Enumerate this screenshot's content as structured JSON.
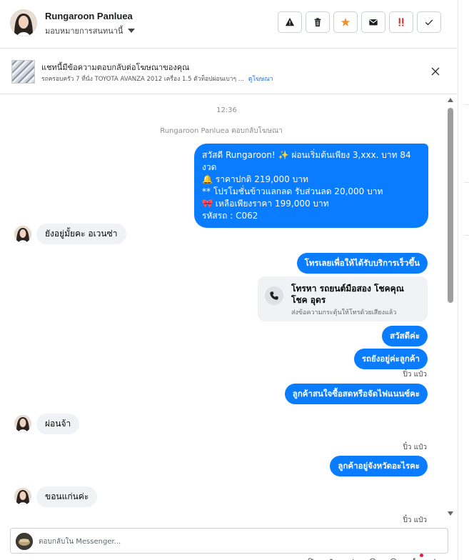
{
  "header": {
    "contact_name": "Rungaroon Panluea",
    "assign_label": "มอบหมายการสนทนานี้",
    "actions": [
      {
        "name": "report-button",
        "icon": "warning-icon"
      },
      {
        "name": "delete-button",
        "icon": "trash-icon"
      },
      {
        "name": "star-button",
        "icon": "star-icon"
      },
      {
        "name": "mark-unread-button",
        "icon": "envelope-icon"
      },
      {
        "name": "spam-button",
        "icon": "spam-icon"
      },
      {
        "name": "done-button",
        "icon": "check-icon"
      }
    ]
  },
  "ad": {
    "title": "แชทนี้มีข้อความตอบกลับต่อโฆษณาของคุณ",
    "subtitle": "รถครอบครัว 7 ที่นั่ง TOYOTA AVANZA 2012 เครื่อง 1.5 ตัวท็อปผ่อนเบาๆ ...",
    "link": "ดูโฆษณา"
  },
  "chat": {
    "timestamp": "12:36",
    "system_note": "Rungaroon Panluea ตอบกลับโฆษณา",
    "promo_lines": [
      "สวัสดี Rungaroon! ✨  ผ่อนเริ่มต้นเพียง 3,xxx. บาท 84 งวด",
      "🔔 ราคาปกติ 219,000 บาท",
      "** โปรโมชั่นข้าวแลกลด รับส่วนลด 20,000 บาท",
      "🎀  เหลือเพียงราคา 199,000 บาท",
      " รหัสรถ : C062"
    ],
    "in_1": "ยังอยู่มั้ยคะ อเวนซ่า",
    "out_call_prompt": "โทรเลยเพื่อให้ได้รับบริการเร็วขึ้น",
    "call_card": {
      "title": "โทรหา รถยนต์มือสอง โชคคุณโชค อุดร",
      "subtitle": "ส่งข้อความกระตุ้นให้โทรด้วยเสียงแล้ว"
    },
    "out_hello": "สวัสดีค่ะ",
    "out_still_there": "รถยังอยู่ค่ะลูกค้า",
    "seen_by_1": "ปิ๋ว แป๋ว",
    "out_question": "ลูกค้าสนใจซื้อสดหรือจัดไฟแนนซ์คะ",
    "in_2": "ผ่อนจ้า",
    "seen_by_2": "ปิ๋ว แป๋ว",
    "out_province": "ลูกค้าอยู่จังหวัดอะไรคะ",
    "in_3": "ขอนแก่นค่ะ",
    "seen_by_3": "ปิ๋ว แป๋ว"
  },
  "composer": {
    "placeholder": "ตอบกลับใน Messenger..."
  },
  "colors": {
    "outgoing_bubble": "#0a7cff",
    "incoming_bubble": "#f0f2f5",
    "link": "#216fdb"
  }
}
